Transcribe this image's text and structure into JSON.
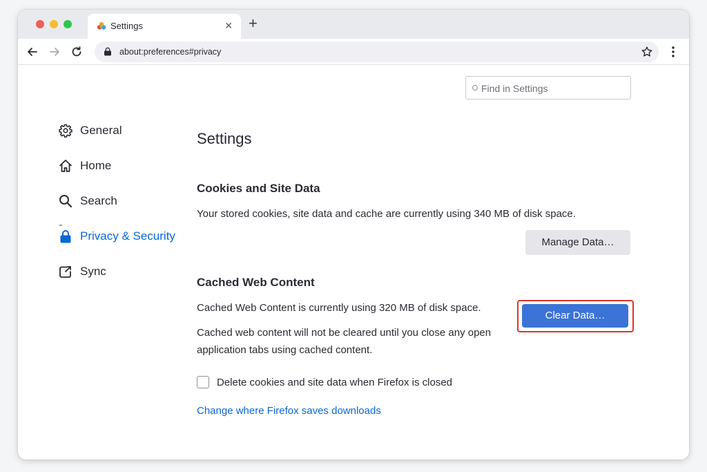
{
  "browser": {
    "tab": {
      "title": "Settings",
      "close_glyph": "✕"
    },
    "new_tab_glyph": "+",
    "url": "about:preferences#privacy"
  },
  "search": {
    "placeholder": "Find in Settings",
    "value": ""
  },
  "sidebar": {
    "items": [
      {
        "label": "General",
        "icon": "gear-icon",
        "active": false
      },
      {
        "label": "Home",
        "icon": "home-icon",
        "active": false
      },
      {
        "label": "Search",
        "icon": "search-icon",
        "active": false
      },
      {
        "label": "Privacy & Security",
        "icon": "lock-icon",
        "active": true
      },
      {
        "label": "Sync",
        "icon": "sync-icon",
        "active": false
      }
    ]
  },
  "main": {
    "title": "Settings",
    "cookies": {
      "heading": "Cookies and Site Data",
      "description": "Your stored cookies, site data and cache are currently using 340 MB of disk space.",
      "manage_button": "Manage Data…"
    },
    "cache": {
      "heading": "Cached Web Content",
      "usage": "Cached Web Content is currently using 320 MB of disk space.",
      "note_line1": "Cached web content will not be cleared until you close any open",
      "note_line2": "application tabs using cached content.",
      "clear_button": "Clear Data…"
    },
    "delete_on_close": {
      "label": "Delete cookies and site data when Firefox is closed",
      "checked": false
    },
    "downloads_link": "Change where Firefox saves downloads"
  },
  "colors": {
    "accent": "#0a67d4",
    "primary_button": "#3b73d6",
    "highlight": "#e0312c"
  }
}
